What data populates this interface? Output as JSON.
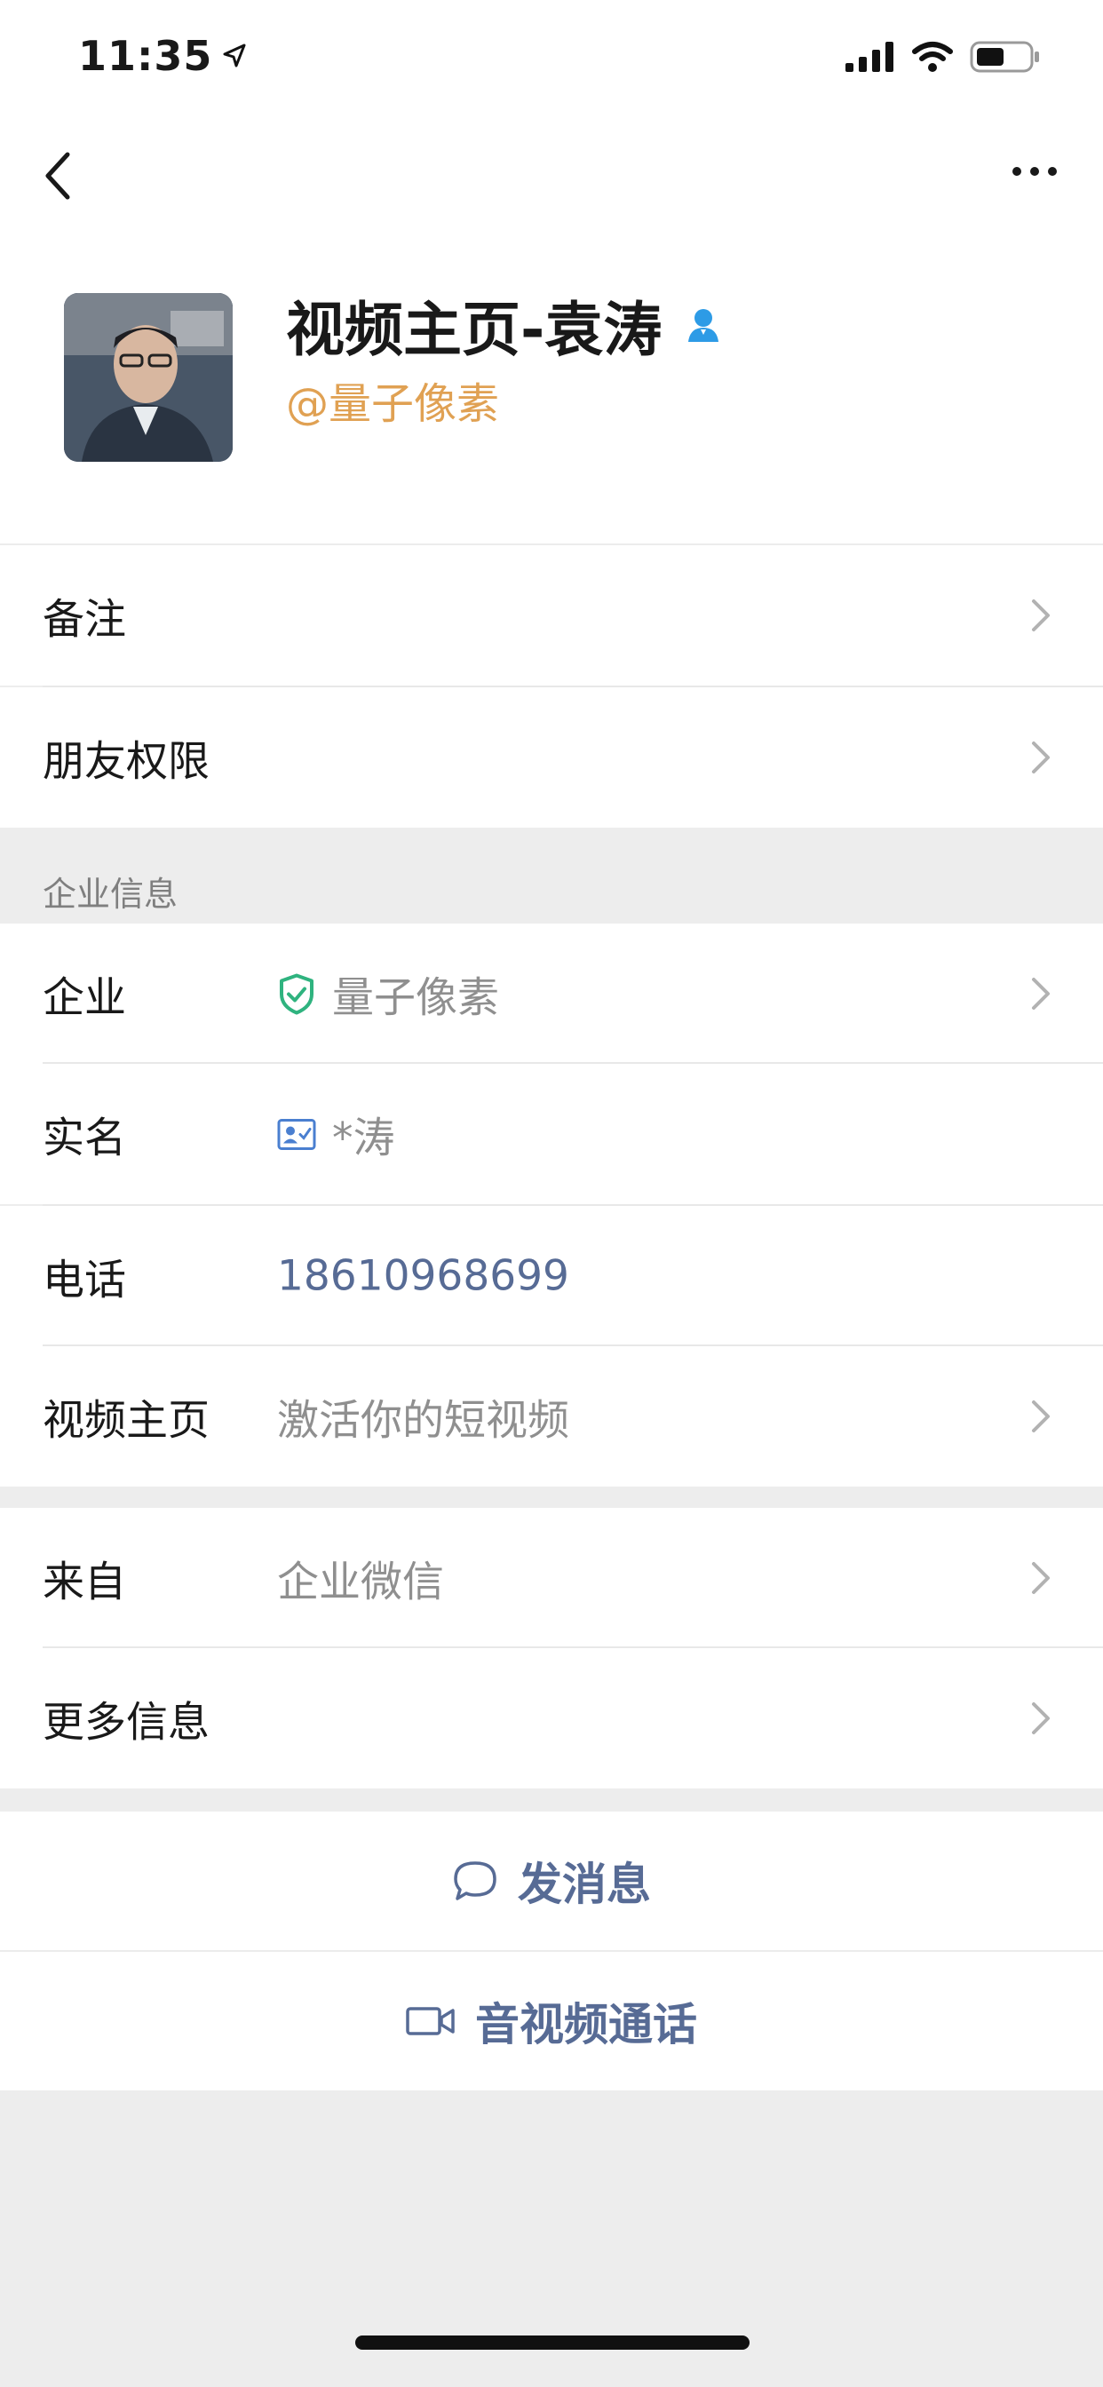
{
  "status_bar": {
    "time": "11:35"
  },
  "profile": {
    "name": "视频主页-袁涛",
    "corp_tag": "@量子像素"
  },
  "menu_top": [
    {
      "label": "备注"
    },
    {
      "label": "朋友权限"
    }
  ],
  "enterprise_section": {
    "title": "企业信息",
    "company_label": "企业",
    "company_value": "量子像素",
    "realname_label": "实名",
    "realname_value": "*涛",
    "phone_label": "电话",
    "phone_value": "18610968699",
    "video_label": "视频主页",
    "video_value": "激活你的短视频"
  },
  "source_section": {
    "from_label": "来自",
    "from_value": "企业微信",
    "more_label": "更多信息"
  },
  "actions": {
    "message": "发消息",
    "call": "音视频通话"
  },
  "colors": {
    "accent_blue": "#576b95",
    "tag_orange": "#e0a153",
    "verify_green": "#2fb37f",
    "background": "#ededed"
  }
}
